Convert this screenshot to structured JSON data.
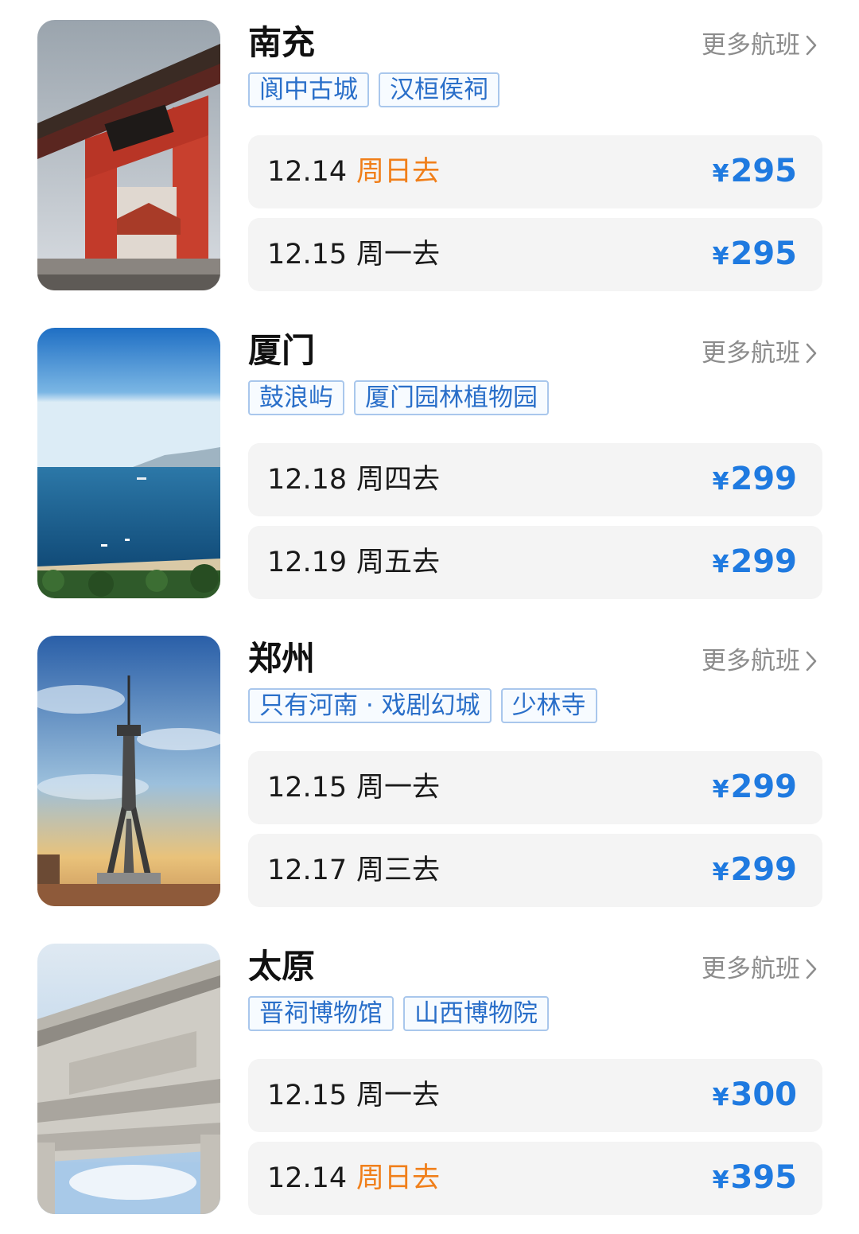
{
  "more_flights_label": "更多航班",
  "currency_symbol": "¥",
  "colors": {
    "tag_text": "#2a6fc9",
    "tag_border": "#a9c7ec",
    "price": "#1f7ae0",
    "weekend": "#f07f1a",
    "row_bg": "#f4f4f4"
  },
  "destinations": [
    {
      "city": "南充",
      "image": "nanchong-red-gate-photo",
      "tags": [
        "阆中古城",
        "汉桓侯祠"
      ],
      "flights": [
        {
          "date": "12.14",
          "weekday": "周日去",
          "weekend": true,
          "price": "295"
        },
        {
          "date": "12.15",
          "weekday": "周一去",
          "weekend": false,
          "price": "295"
        }
      ]
    },
    {
      "city": "厦门",
      "image": "xiamen-sea-photo",
      "tags": [
        "鼓浪屿",
        "厦门园林植物园"
      ],
      "flights": [
        {
          "date": "12.18",
          "weekday": "周四去",
          "weekend": false,
          "price": "299"
        },
        {
          "date": "12.19",
          "weekday": "周五去",
          "weekend": false,
          "price": "299"
        }
      ]
    },
    {
      "city": "郑州",
      "image": "zhengzhou-tower-photo",
      "tags": [
        "只有河南 · 戏剧幻城",
        "少林寺"
      ],
      "flights": [
        {
          "date": "12.15",
          "weekday": "周一去",
          "weekend": false,
          "price": "299"
        },
        {
          "date": "12.17",
          "weekday": "周三去",
          "weekend": false,
          "price": "299"
        }
      ]
    },
    {
      "city": "太原",
      "image": "taiyuan-stone-arch-photo",
      "tags": [
        "晋祠博物馆",
        "山西博物院"
      ],
      "flights": [
        {
          "date": "12.15",
          "weekday": "周一去",
          "weekend": false,
          "price": "300"
        },
        {
          "date": "12.14",
          "weekday": "周日去",
          "weekend": true,
          "price": "395"
        }
      ]
    }
  ]
}
